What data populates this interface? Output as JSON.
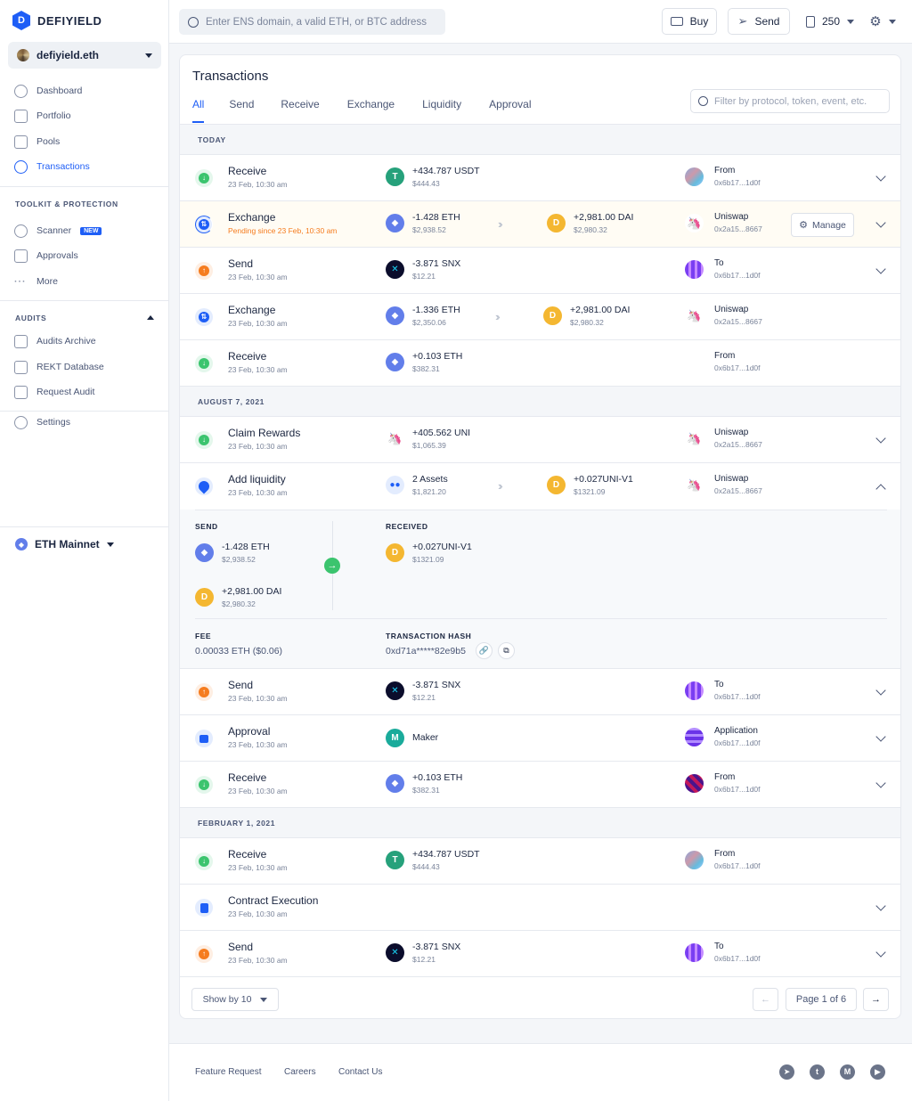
{
  "brand": {
    "name": "DEFIYIELD"
  },
  "account": {
    "name": "defiyield.eth"
  },
  "sidebar": {
    "main": [
      {
        "label": "Dashboard"
      },
      {
        "label": "Portfolio"
      },
      {
        "label": "Pools"
      },
      {
        "label": "Transactions"
      }
    ],
    "toolkit_title": "TOOLKIT & PROTECTION",
    "toolkit": [
      {
        "label": "Scanner",
        "badge": "NEW"
      },
      {
        "label": "Approvals"
      },
      {
        "label": "More"
      }
    ],
    "audits_title": "AUDITS",
    "audits": [
      {
        "label": "Audits Archive"
      },
      {
        "label": "REKT Database"
      },
      {
        "label": "Request Audit"
      }
    ],
    "settings": "Settings",
    "network": "ETH Mainnet"
  },
  "topbar": {
    "search_placeholder": "Enter ENS domain, a valid ETH, or BTC address",
    "buy": "Buy",
    "send": "Send",
    "gas": "250"
  },
  "page": {
    "title": "Transactions",
    "filter_placeholder": "Filter by protocol, token, event, etc."
  },
  "tabs": [
    "All",
    "Send",
    "Receive",
    "Exchange",
    "Liquidity",
    "Approval"
  ],
  "groups": [
    "TODAY",
    "AUGUST 7, 2021",
    "FEBRUARY 1, 2021"
  ],
  "rows": [
    {
      "title": "Receive",
      "sub": "23 Feb, 10:30 am",
      "t1a": "+434.787 USDT",
      "t1u": "$444.43",
      "cpl": "From",
      "cpa": "0x6b17...1d0f"
    },
    {
      "title": "Exchange",
      "sub": "Pending since 23 Feb, 10:30 am",
      "t1a": "-1.428 ETH",
      "t1u": "$2,938.52",
      "t2a": "+2,981.00 DAI",
      "t2u": "$2,980.32",
      "cpl": "Uniswap",
      "cpa": "0x2a15...8667",
      "manage": "Manage"
    },
    {
      "title": "Send",
      "sub": "23 Feb, 10:30 am",
      "t1a": "-3.871 SNX",
      "t1u": "$12.21",
      "cpl": "To",
      "cpa": "0x6b17...1d0f"
    },
    {
      "title": "Exchange",
      "sub": "23 Feb, 10:30 am",
      "t1a": "-1.336 ETH",
      "t1u": "$2,350.06",
      "t2a": "+2,981.00 DAI",
      "t2u": "$2,980.32",
      "cpl": "Uniswap",
      "cpa": "0x2a15...8667"
    },
    {
      "title": "Receive",
      "sub": "23 Feb, 10:30 am",
      "t1a": "+0.103 ETH",
      "t1u": "$382.31",
      "cpl": "From",
      "cpa": "0x6b17...1d0f"
    },
    {
      "title": "Claim Rewards",
      "sub": "23 Feb, 10:30 am",
      "t1a": "+405.562 UNI",
      "t1u": "$1,065.39",
      "cpl": "Uniswap",
      "cpa": "0x2a15...8667"
    },
    {
      "title": "Add liquidity",
      "sub": "23 Feb, 10:30 am",
      "t1a": "2 Assets",
      "t1u": "$1,821.20",
      "t2a": "+0.027UNI-V1",
      "t2u": "$1321.09",
      "cpl": "Uniswap",
      "cpa": "0x2a15...8667"
    },
    {
      "title": "Send",
      "sub": "23 Feb, 10:30 am",
      "t1a": "-3.871 SNX",
      "t1u": "$12.21",
      "cpl": "To",
      "cpa": "0x6b17...1d0f"
    },
    {
      "title": "Approval",
      "sub": "23 Feb, 10:30 am",
      "t1a": "Maker",
      "cpl": "Application",
      "cpa": "0x6b17...1d0f"
    },
    {
      "title": "Receive",
      "sub": "23 Feb, 10:30 am",
      "t1a": "+0.103 ETH",
      "t1u": "$382.31",
      "cpl": "From",
      "cpa": "0x6b17...1d0f"
    },
    {
      "title": "Receive",
      "sub": "23 Feb, 10:30 am",
      "t1a": "+434.787 USDT",
      "t1u": "$444.43",
      "cpl": "From",
      "cpa": "0x6b17...1d0f"
    },
    {
      "title": "Contract Execution",
      "sub": "23 Feb, 10:30 am"
    },
    {
      "title": "Send",
      "sub": "23 Feb, 10:30 am",
      "t1a": "-3.871 SNX",
      "t1u": "$12.21",
      "cpl": "To",
      "cpa": "0x6b17...1d0f"
    }
  ],
  "details": {
    "send_label": "SEND",
    "received_label": "RECEIVED",
    "send": [
      {
        "a": "-1.428 ETH",
        "u": "$2,938.52"
      },
      {
        "a": "+2,981.00 DAI",
        "u": "$2,980.32"
      }
    ],
    "received": [
      {
        "a": "+0.027UNI-V1",
        "u": "$1321.09"
      }
    ],
    "fee_label": "FEE",
    "fee": "0.00033 ETH ($0.06)",
    "hash_label": "TRANSACTION HASH",
    "hash": "0xd71a*****82e9b5"
  },
  "pager": {
    "show_by": "Show by 10",
    "page": "Page 1 of 6"
  },
  "footer": {
    "links": [
      "Feature Request",
      "Careers",
      "Contact Us"
    ]
  },
  "colors": {
    "accent": "#1e5ef6",
    "receive": "#3bc46e",
    "send": "#f57c1f",
    "eth": "#627eea",
    "dai": "#f4b731",
    "usdt": "#26a17b",
    "snx": "#0b0d2c",
    "uni": "#ff007a",
    "maker": "#1aab9b"
  },
  "icons": {
    "receive": "arrow-down-icon",
    "send": "arrow-up-icon",
    "exchange": "swap-icon",
    "liquidity": "drop-icon",
    "approval": "lock-icon",
    "contract": "document-icon"
  }
}
